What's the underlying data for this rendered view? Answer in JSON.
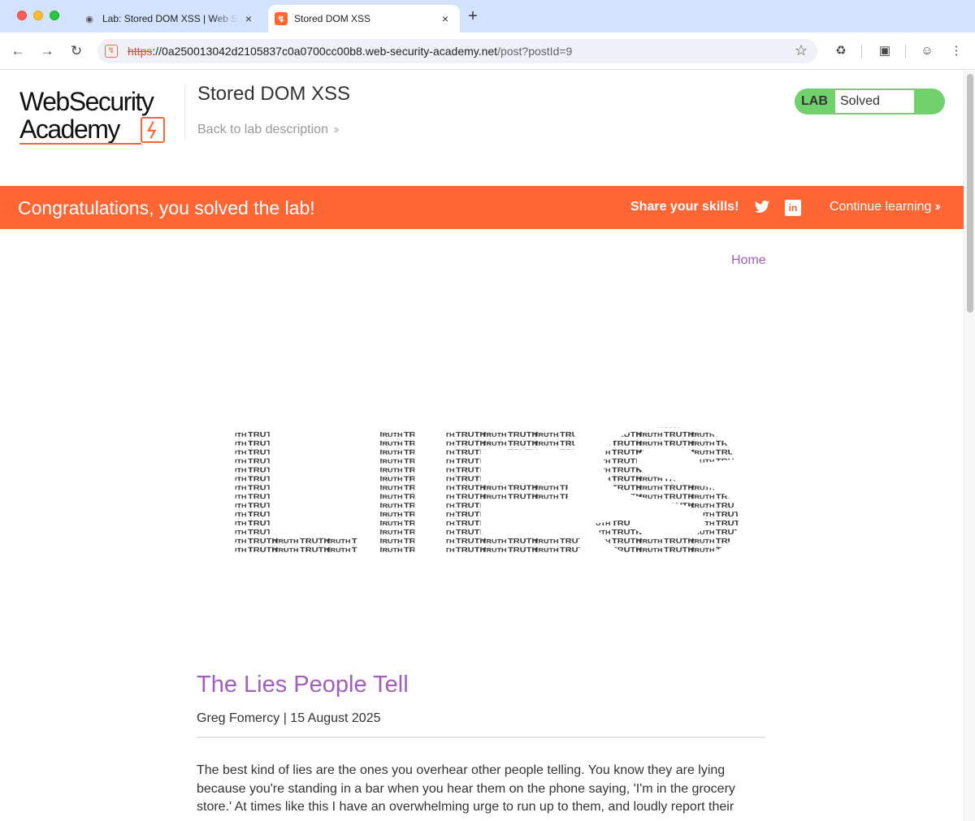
{
  "browser": {
    "tabs": [
      {
        "title": "Lab: Stored DOM XSS | Web Security Academy",
        "active": false
      },
      {
        "title": "Stored DOM XSS",
        "active": true
      }
    ],
    "url": {
      "scheme": "https",
      "host": "://0a250013042d2105837c0a0700cc00b8.web-security-academy.net",
      "path": "/post?postId=9"
    }
  },
  "header": {
    "logo_line1": "WebSecurity",
    "logo_line2": "Academy",
    "lab_title": "Stored DOM XSS",
    "back_link": "Back to lab description",
    "lab_badge_label": "LAB",
    "lab_status": "Solved"
  },
  "banner": {
    "message": "Congratulations, you solved the lab!",
    "share": "Share your skills!",
    "continue": "Continue learning"
  },
  "nav": {
    "home": "Home"
  },
  "hero": {
    "word": "LIES",
    "fill_word": "TRUTH"
  },
  "post": {
    "title": "The Lies People Tell",
    "meta": "Greg Fomercy | 15 August 2025",
    "body": "The best kind of lies are the ones you overhear other people telling. You know they are lying because you're standing in a bar when you hear them on the phone saying, 'I'm in the grocery store.' At times like this I have an overwhelming urge to run up to them, and loudly report their"
  },
  "colors": {
    "brand_orange": "#ff6633",
    "link_purple": "#a55ebb",
    "solved_green": "#70d16d",
    "tabbar": "#d3e3fd"
  }
}
